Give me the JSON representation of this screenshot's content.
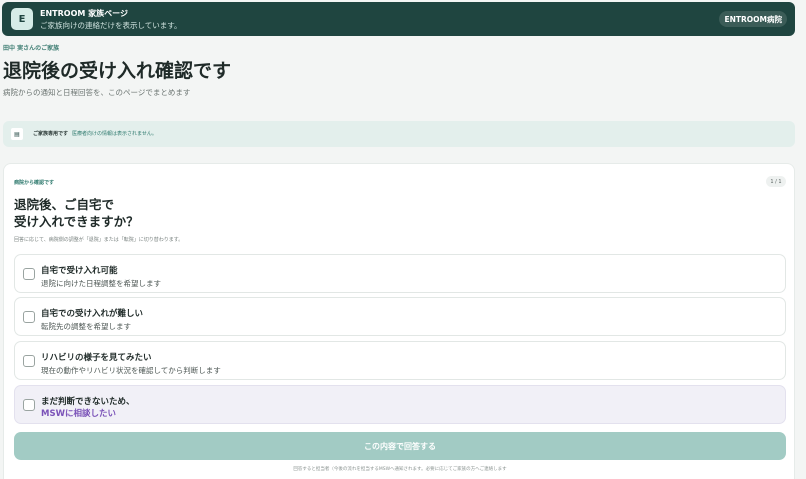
{
  "header": {
    "logo_letter": "E",
    "title": "ENTROOM 家族ページ",
    "subtitle": "ご家族向けの連絡だけを表示しています。",
    "hospital_badge": "ENTROOM病院"
  },
  "breadcrumb": "田中 実さんのご家族",
  "page": {
    "title": "退院後の受け入れ確認です",
    "subtitle": "病院からの通知と日程回答を、このページでまとめます"
  },
  "notice": {
    "icon": "doc-icon",
    "icon_glyph": "▤",
    "label": "ご家族専用です",
    "text": "医療者向けの情報は表示されません。"
  },
  "card": {
    "eyebrow": "病院から確認です",
    "counter": "1 / 1",
    "question_line1": "退院後、ご自宅で",
    "question_line2": "受け入れできますか？",
    "hint": "回答に応じて、病院側の調整が「退院」または「転院」に切り替わります。",
    "options": [
      {
        "title": "自宅で受け入れ可能",
        "desc": "退院に向けた日程調整を希望します"
      },
      {
        "title": "自宅での受け入れが難しい",
        "desc": "転院先の調整を希望します"
      },
      {
        "title": "リハビリの様子を見てみたい",
        "desc": "現在の動作やリハビリ状況を確認してから判断します"
      },
      {
        "title": "まだ判断できないため、",
        "desc": "MSWに相談したい"
      }
    ],
    "submit_label": "この内容で回答する",
    "footnote": "回答すると担当者（今後の流れを担当するMSWへ通知されます。必要に応じてご家族の方へご連絡します"
  }
}
